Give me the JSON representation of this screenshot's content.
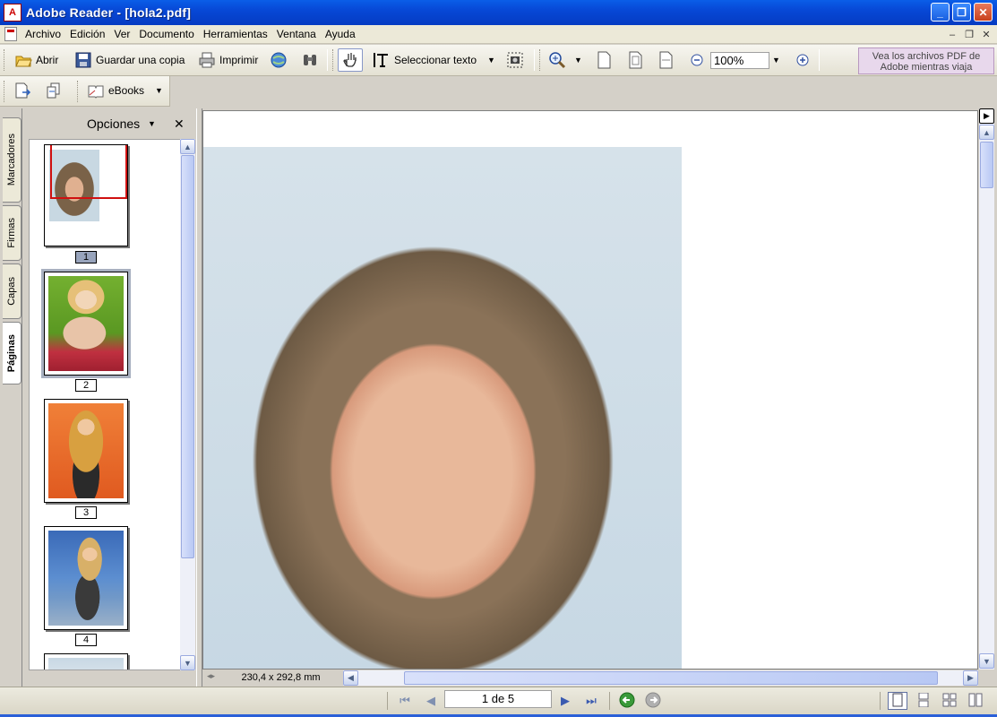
{
  "window": {
    "title": "Adobe Reader - [hola2.pdf]",
    "app_icon": "adobe-reader-icon"
  },
  "menu": {
    "items": [
      "Archivo",
      "Edición",
      "Ver",
      "Documento",
      "Herramientas",
      "Ventana",
      "Ayuda"
    ]
  },
  "toolbar": {
    "open": "Abrir",
    "save_copy": "Guardar una copia",
    "print": "Imprimir",
    "select_text": "Seleccionar texto",
    "zoom": "100%",
    "ebooks": "eBooks"
  },
  "ad": {
    "line1": "Vea los archivos PDF de",
    "line2": "Adobe mientras viaja"
  },
  "nav_tabs": [
    "Marcadores",
    "Firmas",
    "Capas",
    "Páginas"
  ],
  "panel": {
    "options_label": "Opciones",
    "close": "✕"
  },
  "thumbnails": [
    {
      "number": "1",
      "selected": true
    },
    {
      "number": "2",
      "selected": false
    },
    {
      "number": "3",
      "selected": false
    },
    {
      "number": "4",
      "selected": false
    }
  ],
  "status": {
    "page_size": "230,4 x 292,8 mm"
  },
  "navigation": {
    "page_indicator": "1 de 5"
  },
  "colors": {
    "title_bar": "#0748d6",
    "menu_bg": "#ece9d8",
    "workspace": "#d4d0c8",
    "ad_bg": "#e8d8ec"
  }
}
